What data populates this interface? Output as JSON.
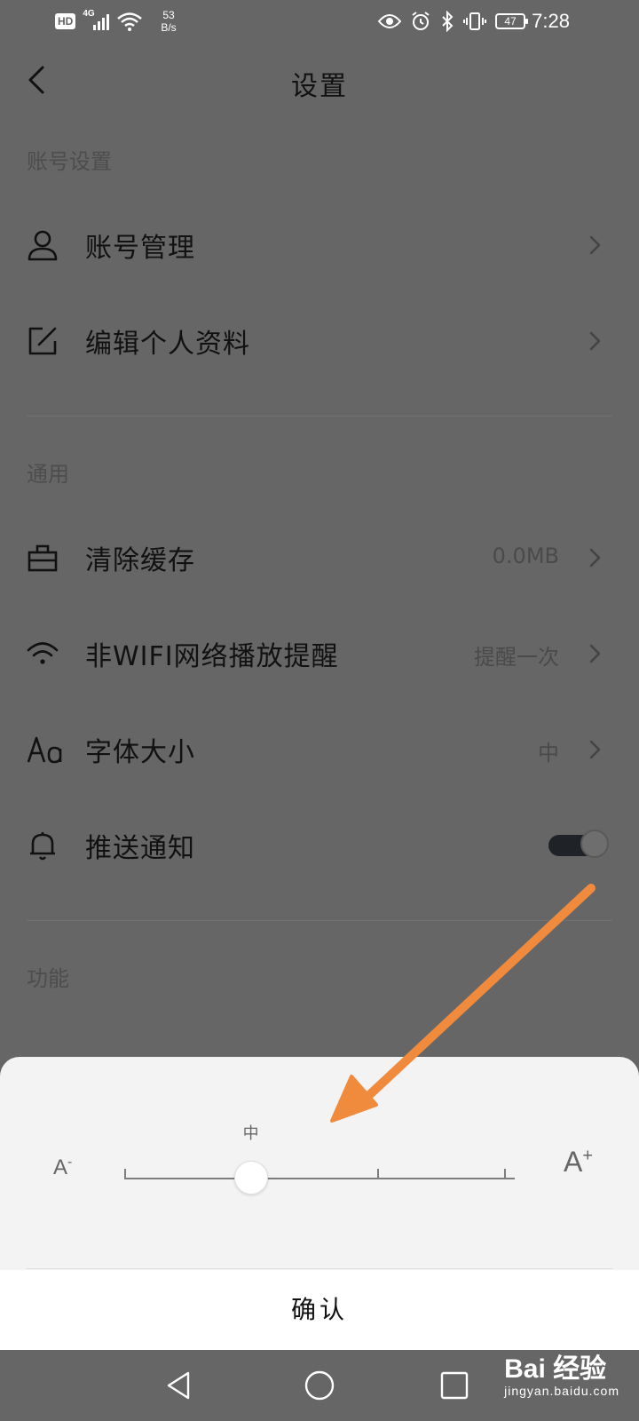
{
  "status_bar": {
    "hd": "HD",
    "network": "4G",
    "speed_value": "53",
    "speed_unit": "B/s",
    "battery": "47",
    "time": "7:28"
  },
  "header": {
    "title": "设置"
  },
  "sections": {
    "account": "账号设置",
    "general": "通用",
    "features": "功能"
  },
  "rows": {
    "account_management": "账号管理",
    "edit_profile": "编辑个人资料",
    "clear_cache": "清除缓存",
    "clear_cache_value": "0.0MB",
    "non_wifi_reminder": "非WIFI网络播放提醒",
    "non_wifi_reminder_value": "提醒一次",
    "font_size": "字体大小",
    "font_size_value": "中",
    "push_notifications": "推送通知",
    "push_notifications_on": true
  },
  "font_sheet": {
    "small_label": "A",
    "small_label_mark": "-",
    "large_label": "A",
    "large_label_mark": "+",
    "current_level": "中",
    "level_count": 4,
    "selected_index": 1,
    "confirm": "确认"
  },
  "watermark": {
    "main": "Bai  经验",
    "sub": "jingyan.baidu.com"
  },
  "colors": {
    "overlay": "#666666",
    "sheet": "#f3f3f3",
    "arrow": "#f08a3c",
    "toggle_track": "#1f2227"
  },
  "icons": {
    "back": "chevron-left-icon",
    "account": "person-icon",
    "edit": "edit-square-icon",
    "cache": "briefcase-icon",
    "wifi": "wifi-icon",
    "font": "text-aa-icon",
    "bell": "bell-icon"
  }
}
